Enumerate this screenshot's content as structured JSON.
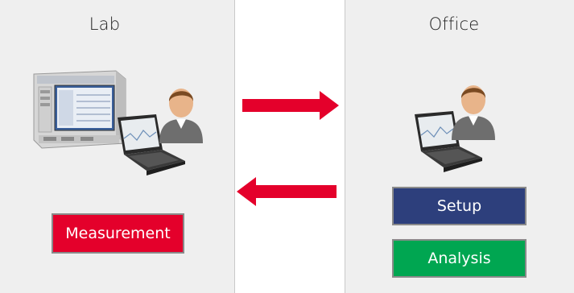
{
  "lab": {
    "title": "Lab",
    "button": "Measurement",
    "button_color": "#e4002b"
  },
  "office": {
    "title": "Office",
    "setup_button": "Setup",
    "analysis_button": "Analysis",
    "setup_color": "#2d3f7c",
    "analysis_color": "#00a651"
  },
  "arrows": {
    "color": "#e4002b",
    "right_icon": "arrow-right-icon",
    "left_icon": "arrow-left-icon"
  },
  "icons": [
    "instrument-icon",
    "laptop-icon",
    "user-icon"
  ]
}
